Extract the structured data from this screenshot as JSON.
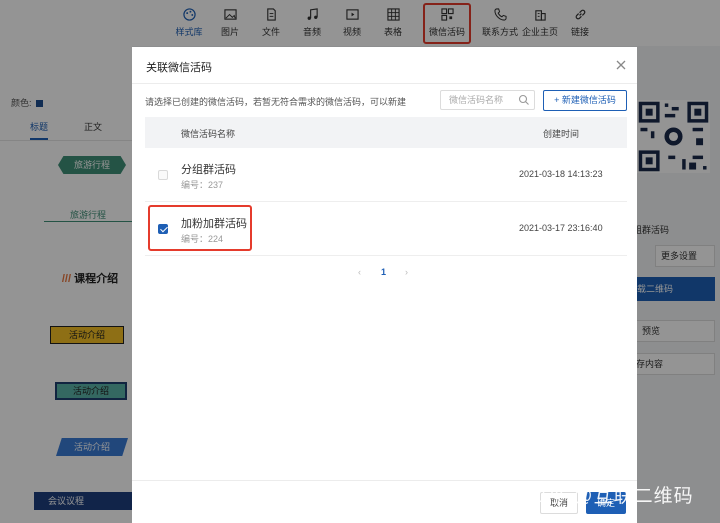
{
  "toolbar": {
    "items": [
      {
        "label": "样式库",
        "icon": "palette-icon"
      },
      {
        "label": "图片",
        "icon": "image-icon"
      },
      {
        "label": "文件",
        "icon": "file-icon"
      },
      {
        "label": "音频",
        "icon": "music-icon"
      },
      {
        "label": "视频",
        "icon": "video-icon"
      },
      {
        "label": "表格",
        "icon": "table-icon"
      },
      {
        "label": "微信活码",
        "icon": "qrcode-icon"
      },
      {
        "label": "联系方式",
        "icon": "phone-icon"
      },
      {
        "label": "企业主页",
        "icon": "building-icon"
      },
      {
        "label": "链接",
        "icon": "link-icon"
      }
    ]
  },
  "left_panel": {
    "color_label": "颜色:",
    "tabs": [
      "标题",
      "正文"
    ],
    "samples": [
      "旅游行程",
      "旅游行程",
      "课程介绍",
      "活动介绍",
      "活动介绍",
      "活动介绍",
      "会议议程"
    ]
  },
  "right_panel": {
    "group_label": "组群活码",
    "more_settings": "更多设置",
    "download_qr": "载二维码",
    "preview": "预览",
    "save_content": "存内容"
  },
  "modal": {
    "title": "关联微信活码",
    "description": "请选择已创建的微信活码，若暂无符合需求的微信活码，可以新建",
    "search_placeholder": "微信活码名称",
    "new_button": "+ 新建微信活码",
    "columns": {
      "name": "微信活码名称",
      "time": "创建时间"
    },
    "rows": [
      {
        "name": "分组群活码",
        "code": "编号：237",
        "time": "2021-03-18 14:13:23",
        "checked": false
      },
      {
        "name": "加粉加群活码",
        "code": "编号：224",
        "time": "2021-03-17 23:16:40",
        "checked": true
      }
    ],
    "pagination": {
      "prev": "‹",
      "page": "1",
      "next": "›"
    },
    "footer": {
      "cancel": "取消",
      "ok": "确定"
    }
  },
  "watermark": "知乎 @互联二维码",
  "colors": {
    "accent": "#1e5fb5",
    "highlight": "#e53b2c"
  }
}
